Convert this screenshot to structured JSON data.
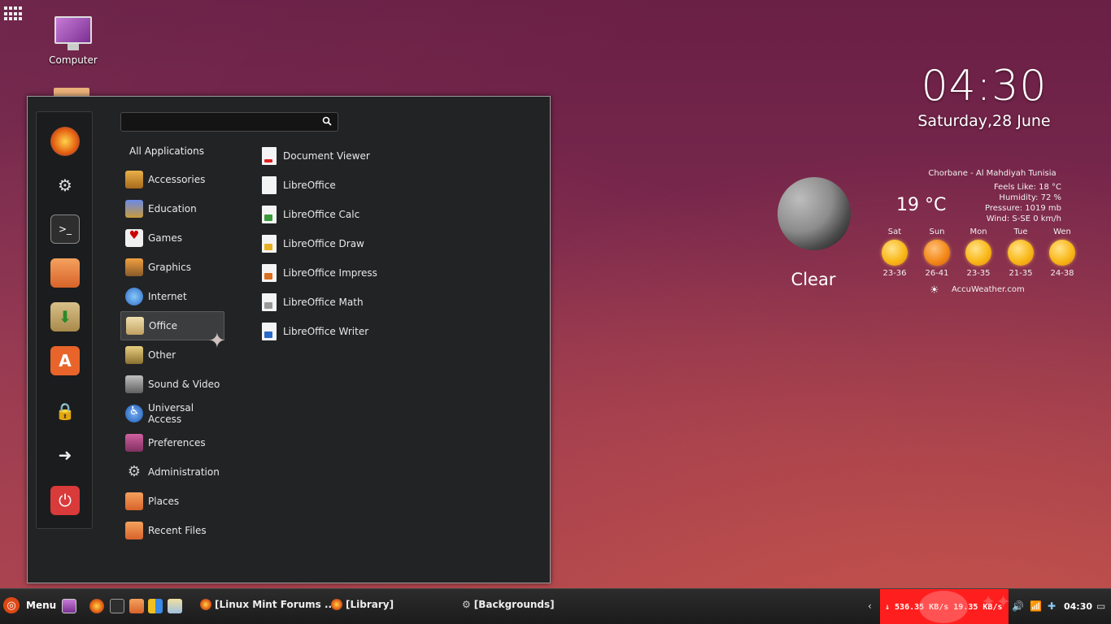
{
  "desktop": {
    "computer_label": "Computer"
  },
  "search": {
    "value": "",
    "placeholder": ""
  },
  "categories_header": "All Applications",
  "categories": [
    "Accessories",
    "Education",
    "Games",
    "Graphics",
    "Internet",
    "Office",
    "Other",
    "Sound & Video",
    "Universal Access",
    "Preferences",
    "Administration",
    "Places",
    "Recent Files"
  ],
  "selected_category": "Office",
  "applications": [
    "Document Viewer",
    "LibreOffice",
    "LibreOffice Calc",
    "LibreOffice Draw",
    "LibreOffice Impress",
    "LibreOffice Math",
    "LibreOffice Writer"
  ],
  "clock": {
    "time": "04:30",
    "date": "Saturday,28 June"
  },
  "weather": {
    "location": "Chorbane - Al Mahdiyah Tunisia",
    "temperature": "19 °C",
    "condition": "Clear",
    "feels_like": "Feels Like: 18 °C",
    "humidity": "Humidity: 72 %",
    "pressure": "Pressure: 1019 mb",
    "wind": "Wind: S-SE 0 km/h",
    "source": "AccuWeather.com",
    "forecast": [
      {
        "day": "Sat",
        "range": "23-36"
      },
      {
        "day": "Sun",
        "range": "26-41"
      },
      {
        "day": "Mon",
        "range": "23-35"
      },
      {
        "day": "Tue",
        "range": "21-35"
      },
      {
        "day": "Wen",
        "range": "24-38"
      }
    ]
  },
  "panel": {
    "menu_label": "Menu",
    "tasks": [
      "[Linux Mint Forums ...",
      "[Library]",
      "[Backgrounds]"
    ],
    "netspeed": "↓ 536.35 KB/s 19.35 KB/s",
    "time": "04:30"
  },
  "colors": {
    "netspeed_bg": "#ff1e1e",
    "menu_bg": "#222324",
    "ubuntu": "#dd4814"
  }
}
